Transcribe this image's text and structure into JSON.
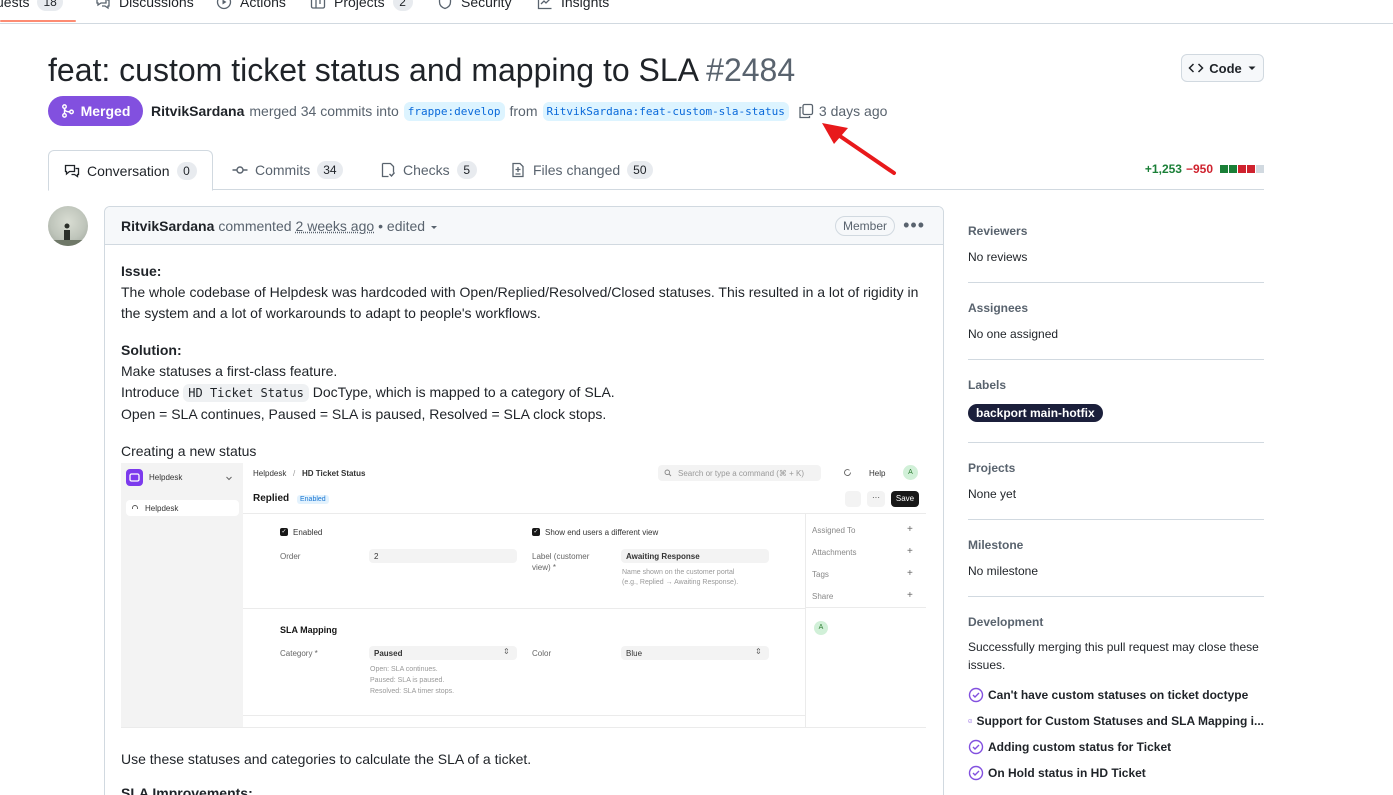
{
  "repo_nav": {
    "pull_requests": {
      "label": "uests",
      "count": "18"
    },
    "discussions": "Discussions",
    "actions": "Actions",
    "projects": {
      "label": "Projects",
      "count": "2"
    },
    "security": "Security",
    "insights": "Insights"
  },
  "pr": {
    "title": "feat: custom ticket status and mapping to SLA",
    "number": "#2484",
    "status": "Merged",
    "author": "RitvikSardana",
    "action_text": "merged 34 commits into",
    "base_branch": "frappe:develop",
    "from_text": "from",
    "head_branch": "RitvikSardana:feat-custom-sla-status",
    "time": "3 days ago",
    "code_button": "Code"
  },
  "tabs": [
    {
      "label": "Conversation",
      "count": "0"
    },
    {
      "label": "Commits",
      "count": "34"
    },
    {
      "label": "Checks",
      "count": "5"
    },
    {
      "label": "Files changed",
      "count": "50"
    }
  ],
  "diffstat": {
    "additions": "+1,253",
    "deletions": "−950"
  },
  "comment": {
    "author": "RitvikSardana",
    "verb": "commented",
    "time": "2 weeks ago",
    "edited": "• edited",
    "role": "Member",
    "issue_heading": "Issue:",
    "issue_text": "The whole codebase of Helpdesk was hardcoded with Open/Replied/Resolved/Closed statuses. This resulted in a lot of rigidity in the system and a lot of workarounds to adapt to people's workflows.",
    "solution_heading": "Solution:",
    "solution_line1": "Make statuses a first-class feature.",
    "solution_line2_pre": "Introduce",
    "solution_line2_code": "HD Ticket Status",
    "solution_line2_post": "DocType, which is mapped to a category of SLA.",
    "solution_line3": "Open = SLA continues, Paused = SLA is paused, Resolved = SLA clock stops.",
    "creating_text": "Creating a new status",
    "use_text": "Use these statuses and categories to calculate the SLA of a ticket.",
    "sla_improvements": "SLA Improvements:"
  },
  "embedded": {
    "app_name": "Helpdesk",
    "sidebar_item": "Helpdesk",
    "breadcrumb_1": "Helpdesk",
    "breadcrumb_sep": "/",
    "breadcrumb_2": "HD Ticket Status",
    "search_placeholder": "Search or type a command (⌘ + K)",
    "help": "Help",
    "user_initial": "A",
    "doc_title": "Replied",
    "doc_badge": "Enabled",
    "save": "Save",
    "enabled_label": "Enabled",
    "show_end_users": "Show end users a different view",
    "order_label": "Order",
    "order_value": "2",
    "label_customer_1": "Label (customer",
    "label_customer_2": "view) *",
    "label_customer_value": "Awaiting Response",
    "label_hint_1": "Name shown on the customer portal",
    "label_hint_2": "(e.g., Replied → Awaiting Response).",
    "assigned_to": "Assigned To",
    "attachments": "Attachments",
    "tags": "Tags",
    "share": "Share",
    "sla_mapping": "SLA Mapping",
    "category_label": "Category *",
    "category_value": "Paused",
    "color_label": "Color",
    "color_value": "Blue",
    "hint_open": "Open: SLA continues.",
    "hint_paused": "Paused: SLA is paused.",
    "hint_resolved": "Resolved: SLA timer stops."
  },
  "sidebar": {
    "reviewers": {
      "heading": "Reviewers",
      "value": "No reviews"
    },
    "assignees": {
      "heading": "Assignees",
      "value": "No one assigned"
    },
    "labels": {
      "heading": "Labels",
      "value": "backport main-hotfix"
    },
    "projects": {
      "heading": "Projects",
      "value": "None yet"
    },
    "milestone": {
      "heading": "Milestone",
      "value": "No milestone"
    },
    "development": {
      "heading": "Development",
      "text": "Successfully merging this pull request may close these issues.",
      "issues": [
        "Can't have custom statuses on ticket doctype",
        "Support for Custom Statuses and SLA Mapping i...",
        "Adding custom status for Ticket",
        "On Hold status in HD Ticket"
      ]
    }
  },
  "colors": {
    "merged": "#8250df",
    "link": "#0969da",
    "additions": "#1a7f37",
    "deletions": "#cf222e",
    "annotation_arrow": "#e8191b"
  }
}
